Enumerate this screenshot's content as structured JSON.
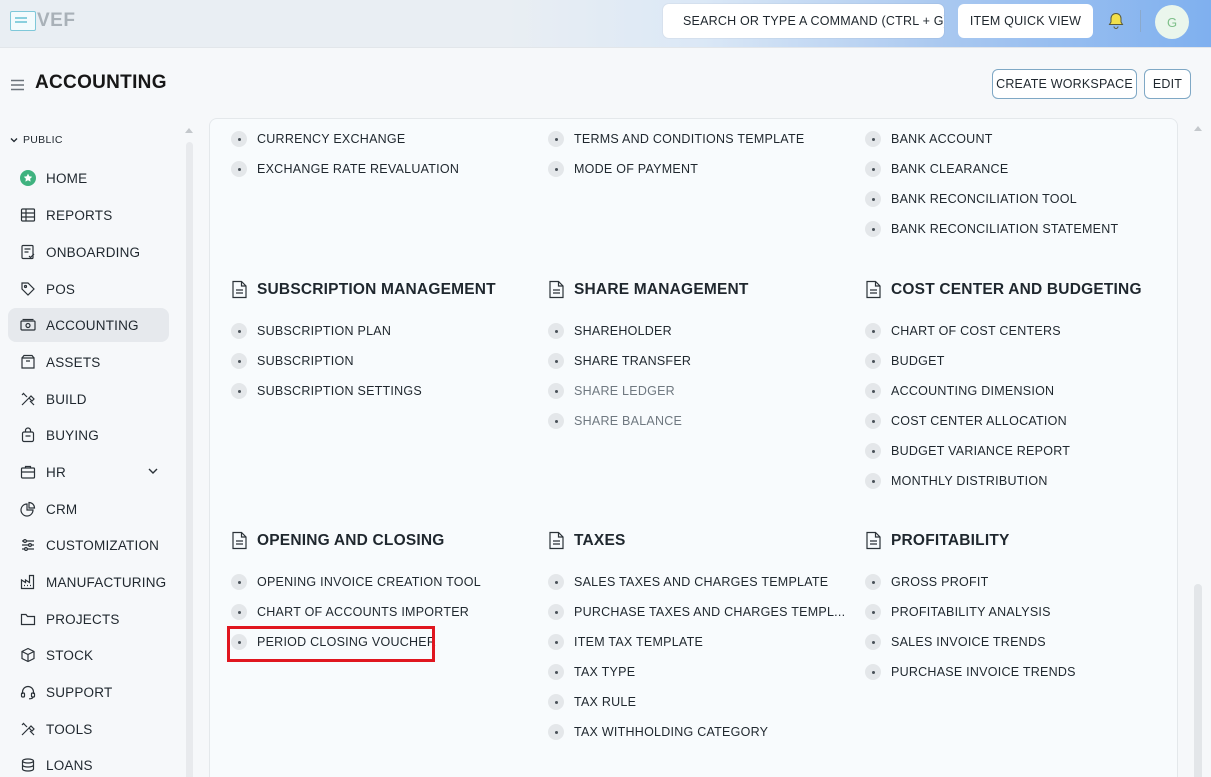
{
  "app": {
    "logo_text": "VEF",
    "search_placeholder": "SEARCH OR TYPE A COMMAND (CTRL + G)",
    "quick_view_label": "ITEM QUICK VIEW",
    "avatar_initial": "G"
  },
  "page": {
    "title": "ACCOUNTING",
    "create_workspace_label": "CREATE WORKSPACE",
    "edit_label": "EDIT"
  },
  "sidebar": {
    "section_label": "PUBLIC",
    "items": [
      {
        "label": "HOME",
        "icon": "home-star-icon"
      },
      {
        "label": "REPORTS",
        "icon": "table-icon"
      },
      {
        "label": "ONBOARDING",
        "icon": "checklist-icon"
      },
      {
        "label": "POS",
        "icon": "tag-icon"
      },
      {
        "label": "ACCOUNTING",
        "icon": "money-icon"
      },
      {
        "label": "ASSETS",
        "icon": "box-icon"
      },
      {
        "label": "BUILD",
        "icon": "tools-icon"
      },
      {
        "label": "BUYING",
        "icon": "bag-icon"
      },
      {
        "label": "HR",
        "icon": "people-icon"
      },
      {
        "label": "CRM",
        "icon": "chart-pie-icon"
      },
      {
        "label": "CUSTOMIZATION",
        "icon": "sliders-icon"
      },
      {
        "label": "MANUFACTURING",
        "icon": "factory-icon"
      },
      {
        "label": "PROJECTS",
        "icon": "folder-icon"
      },
      {
        "label": "STOCK",
        "icon": "cube-icon"
      },
      {
        "label": "SUPPORT",
        "icon": "headset-icon"
      },
      {
        "label": "TOOLS",
        "icon": "wrench-icon"
      },
      {
        "label": "LOANS",
        "icon": "coins-icon"
      }
    ]
  },
  "cards": {
    "top": {
      "col1": [
        "CURRENCY EXCHANGE",
        "EXCHANGE RATE REVALUATION"
      ],
      "col2": [
        "TERMS AND CONDITIONS TEMPLATE",
        "MODE OF PAYMENT"
      ],
      "col3": [
        "BANK ACCOUNT",
        "BANK CLEARANCE",
        "BANK RECONCILIATION TOOL",
        "BANK RECONCILIATION STATEMENT"
      ]
    },
    "subscription": {
      "title": "SUBSCRIPTION MANAGEMENT",
      "links": [
        "SUBSCRIPTION PLAN",
        "SUBSCRIPTION",
        "SUBSCRIPTION SETTINGS"
      ]
    },
    "share": {
      "title": "SHARE MANAGEMENT",
      "links": [
        "SHAREHOLDER",
        "SHARE TRANSFER",
        "SHARE LEDGER",
        "SHARE BALANCE"
      ]
    },
    "cost_center": {
      "title": "COST CENTER AND BUDGETING",
      "links": [
        "CHART OF COST CENTERS",
        "BUDGET",
        "ACCOUNTING DIMENSION",
        "COST CENTER ALLOCATION",
        "BUDGET VARIANCE REPORT",
        "MONTHLY DISTRIBUTION"
      ]
    },
    "opening": {
      "title": "OPENING AND CLOSING",
      "links": [
        "OPENING INVOICE CREATION TOOL",
        "CHART OF ACCOUNTS IMPORTER",
        "PERIOD CLOSING VOUCHER"
      ]
    },
    "taxes": {
      "title": "TAXES",
      "links": [
        "SALES TAXES AND CHARGES TEMPLATE",
        "PURCHASE TAXES AND CHARGES TEMPL...",
        "ITEM TAX TEMPLATE",
        "TAX TYPE",
        "TAX RULE",
        "TAX WITHHOLDING CATEGORY"
      ]
    },
    "profitability": {
      "title": "PROFITABILITY",
      "links": [
        "GROSS PROFIT",
        "PROFITABILITY ANALYSIS",
        "SALES INVOICE TRENDS",
        "PURCHASE INVOICE TRENDS"
      ]
    }
  },
  "colors": {
    "highlight": "#e0161f",
    "home_icon": "#3fb27f"
  }
}
